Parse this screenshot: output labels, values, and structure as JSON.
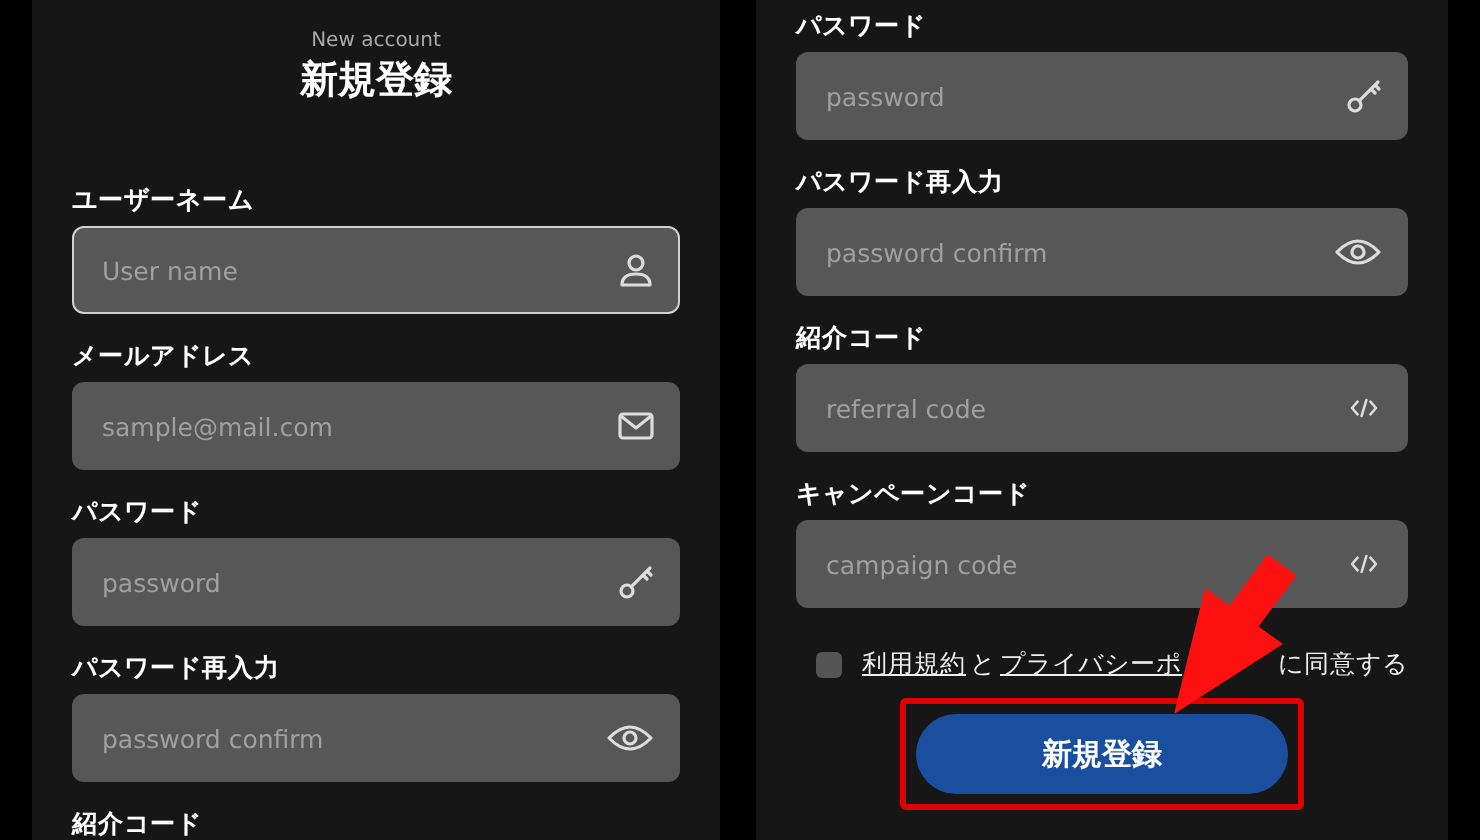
{
  "left_panel": {
    "subtitle": "New account",
    "title": "新規登録",
    "fields": [
      {
        "label": "ユーザーネーム",
        "placeholder": "User name",
        "kind": "username",
        "focused": true
      },
      {
        "label": "メールアドレス",
        "placeholder": "sample@mail.com",
        "kind": "email",
        "focused": false
      },
      {
        "label": "パスワード",
        "placeholder": "password",
        "kind": "password",
        "focused": false
      },
      {
        "label": "パスワード再入力",
        "placeholder": "password confirm",
        "kind": "confirm",
        "focused": false
      },
      {
        "label": "紹介コード"
      }
    ]
  },
  "right_panel": {
    "fields": [
      {
        "label": "パスワード",
        "placeholder": "password",
        "kind": "password",
        "focused": false
      },
      {
        "label": "パスワード再入力",
        "placeholder": "password confirm",
        "kind": "confirm",
        "focused": false
      },
      {
        "label": "紹介コード",
        "placeholder": "referral code",
        "kind": "code",
        "focused": false
      },
      {
        "label": "キャンペーンコード",
        "placeholder": "campaign code",
        "kind": "code",
        "focused": false
      }
    ],
    "agreement": {
      "checked": false,
      "terms_link": "利用規約",
      "joiner": "と",
      "privacy_link": "プライバシーポ",
      "suffix": "に同意する"
    },
    "submit_button": "新規登録"
  }
}
